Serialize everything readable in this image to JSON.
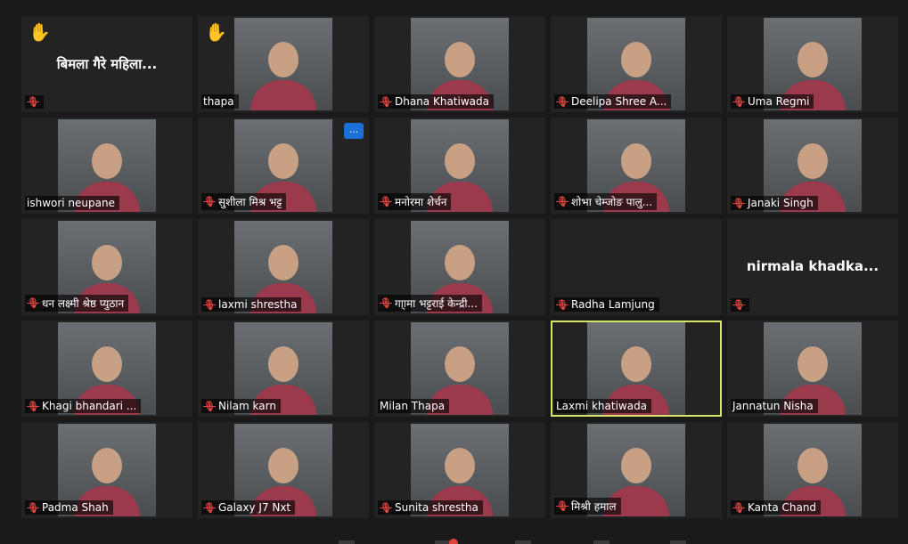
{
  "participants": [
    {
      "name": "बिमला गैरे  महिला...",
      "muted": true,
      "hand_raised": true,
      "video": false,
      "label_visible": false
    },
    {
      "name": "thapa",
      "muted": false,
      "hand_raised": true,
      "video": true
    },
    {
      "name": "Dhana Khatiwada",
      "muted": true,
      "video": true
    },
    {
      "name": "Deelipa Shree A...",
      "muted": true,
      "video": true
    },
    {
      "name": "Uma Regmi",
      "muted": true,
      "video": true
    },
    {
      "name": "ishwori neupane",
      "muted": false,
      "video": true
    },
    {
      "name": "सुशीला मिश्र भट्ट",
      "muted": true,
      "video": true,
      "more_menu": "..."
    },
    {
      "name": "मनोरमा शेर्चन",
      "muted": true,
      "video": true
    },
    {
      "name": "शोभा चेम्जोङ पालु...",
      "muted": true,
      "video": true
    },
    {
      "name": "Janaki Singh",
      "muted": true,
      "video": true
    },
    {
      "name": "धन लक्ष्मी श्रेष्ठ प्युठान",
      "muted": true,
      "video": true
    },
    {
      "name": "laxmi shrestha",
      "muted": true,
      "video": true
    },
    {
      "name": "गा्ामा भट्टराई केन्द्री...",
      "muted": true,
      "video": true
    },
    {
      "name": "Radha Lamjung",
      "muted": true,
      "video": false
    },
    {
      "name": "nirmala  khadka...",
      "muted": true,
      "video": false,
      "label_visible": false
    },
    {
      "name": "Khagi  bhandari ...",
      "muted": true,
      "video": true
    },
    {
      "name": "Nilam karn",
      "muted": true,
      "video": true
    },
    {
      "name": "Milan Thapa",
      "muted": false,
      "video": true
    },
    {
      "name": "Laxmi khatiwada",
      "muted": false,
      "video": true,
      "active_speaker": true
    },
    {
      "name": "Jannatun Nisha",
      "muted": false,
      "video": true
    },
    {
      "name": "Padma Shah",
      "muted": true,
      "video": true
    },
    {
      "name": "Galaxy J7 Nxt",
      "muted": true,
      "video": true
    },
    {
      "name": "Sunita shrestha",
      "muted": true,
      "video": true
    },
    {
      "name": "मिश्री हमाल",
      "muted": true,
      "video": true
    },
    {
      "name": "Kanta Chand",
      "muted": true,
      "video": true
    }
  ],
  "colors": {
    "background": "#1a1a1a",
    "tile": "#232323",
    "active_border": "#d7e46a",
    "muted_icon": "#e0423e",
    "hand": "#f3c44a",
    "more_button": "#1d6fd8"
  },
  "icons": {
    "muted": "mic-off-icon",
    "hand": "raised-hand-icon",
    "more": "more-options-icon"
  },
  "glyphs": {
    "hand": "✋",
    "mic_off": "🎙"
  }
}
